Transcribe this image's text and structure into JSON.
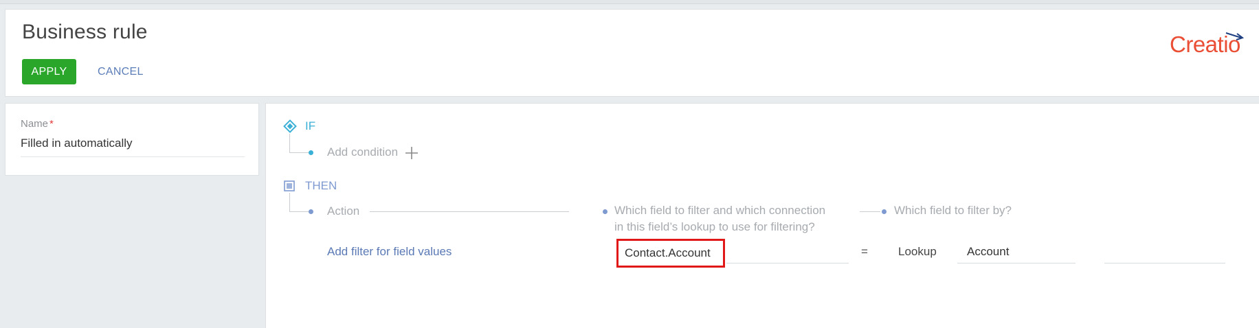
{
  "header": {
    "title": "Business rule",
    "apply_label": "APPLY",
    "cancel_label": "CANCEL",
    "logo_text": "Creatio",
    "logo_color": "#ea4f35"
  },
  "name_panel": {
    "label": "Name",
    "required_mark": "*",
    "value": "Filled in automatically"
  },
  "rule": {
    "if_label": "IF",
    "add_condition_label": "Add condition",
    "then_label": "THEN",
    "action_header": "Action",
    "filter_field_header": "Which field to filter and which connection in this field’s lookup to use for filtering?",
    "filter_by_header": "Which field to filter by?",
    "action_value": "Add filter for field values",
    "filter_field_value": "Contact.Account",
    "operator": "=",
    "value_type": "Lookup",
    "filter_by_value": "Account"
  },
  "colors": {
    "apply_green": "#2aa72a",
    "link_blue": "#5a79b5",
    "if_cyan": "#3bb0d6",
    "highlight_red": "#e01818"
  }
}
